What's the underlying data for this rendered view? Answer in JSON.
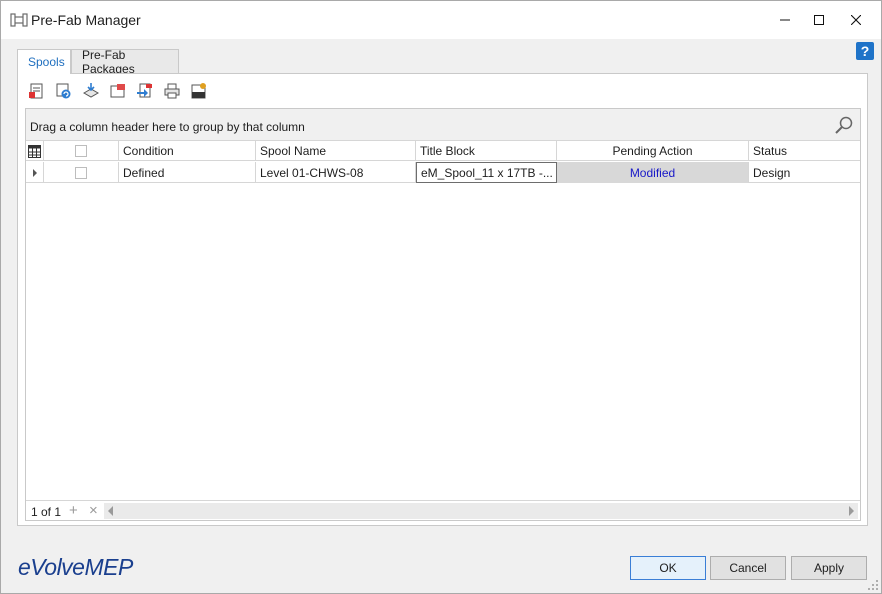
{
  "window": {
    "title": "Pre-Fab Manager"
  },
  "help": {
    "label": "?"
  },
  "tabs": [
    {
      "label": "Spools",
      "active": true
    },
    {
      "label": "Pre-Fab Packages",
      "active": false
    }
  ],
  "grid": {
    "group_hint": "Drag a column header here to group by that column",
    "columns": [
      "Condition",
      "Spool Name",
      "Title Block",
      "Pending Action",
      "Status"
    ],
    "rows": [
      {
        "condition": "Defined",
        "spool_name": "Level 01-CHWS-08",
        "title_block": "eM_Spool_11 x 17TB -...",
        "pending_action": "Modified",
        "status": "Design"
      }
    ],
    "navigator": {
      "count": "1 of 1"
    }
  },
  "footer": {
    "logo": "eVolveMEP",
    "ok_label": "OK",
    "cancel_label": "Cancel",
    "apply_label": "Apply"
  },
  "colors": {
    "accent": "#1f6fbf",
    "pending_text": "#1818c8",
    "pending_bg": "#d8d8d8",
    "logo": "#1a3f8e"
  }
}
